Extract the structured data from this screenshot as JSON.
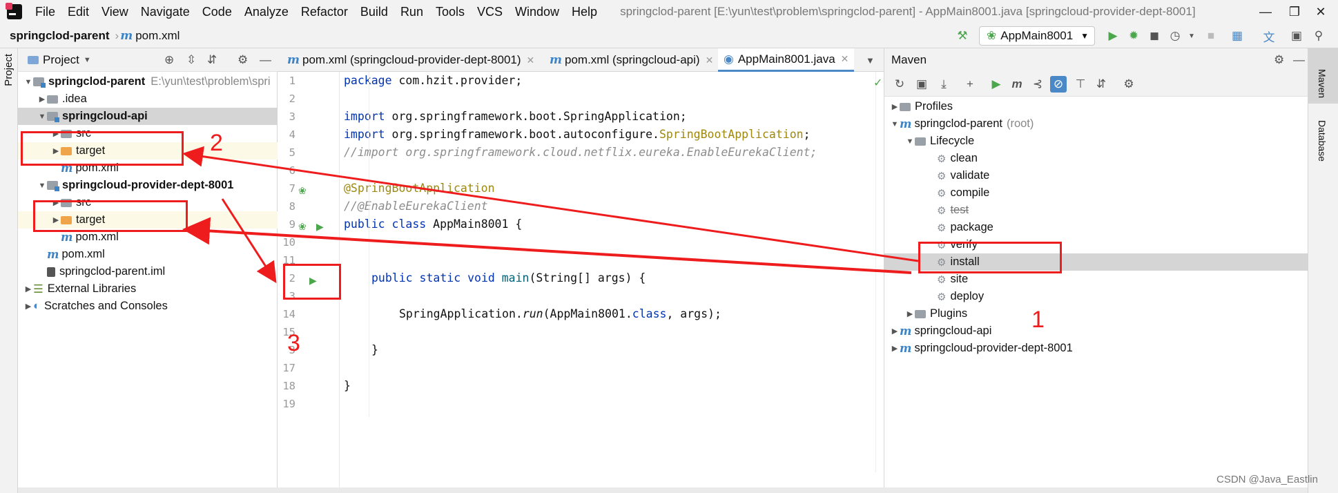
{
  "menubar": {
    "items": [
      "File",
      "Edit",
      "View",
      "Navigate",
      "Code",
      "Analyze",
      "Refactor",
      "Build",
      "Run",
      "Tools",
      "VCS",
      "Window",
      "Help"
    ],
    "window_title": "springclod-parent [E:\\yun\\test\\problem\\springclod-parent] - AppMain8001.java [springcloud-provider-dept-8001]"
  },
  "navbar": {
    "project": "springclod-parent",
    "file": "pom.xml",
    "run_config": "AppMain8001"
  },
  "left_strip": {
    "label": "Project"
  },
  "project_panel": {
    "title": "Project",
    "tree": [
      {
        "label": "springclod-parent",
        "path": "E:\\yun\\test\\problem\\spri"
      },
      {
        "label": ".idea"
      },
      {
        "label": "springcloud-api"
      },
      {
        "label": "src"
      },
      {
        "label": "target"
      },
      {
        "label": "pom.xml"
      },
      {
        "label": "springcloud-provider-dept-8001"
      },
      {
        "label": "src"
      },
      {
        "label": "target"
      },
      {
        "label": "pom.xml"
      },
      {
        "label": "pom.xml"
      },
      {
        "label": "springclod-parent.iml"
      },
      {
        "label": "External Libraries"
      },
      {
        "label": "Scratches and Consoles"
      }
    ]
  },
  "editor": {
    "tabs": [
      "pom.xml (springcloud-provider-dept-8001)",
      "pom.xml (springcloud-api)",
      "AppMain8001.java"
    ],
    "line_numbers": [
      "1",
      "2",
      "3",
      "4",
      "5",
      "6",
      "7",
      "8",
      "9",
      "10",
      "11",
      "2",
      "3",
      "14",
      "15",
      "3",
      "17",
      "18",
      "19"
    ],
    "code": {
      "l1_kw": "package",
      "l1_rest": " com.hzit.provider;",
      "l3_kw": "import",
      "l3_rest": " org.springframework.boot.SpringApplication;",
      "l4_kw": "import",
      "l4_rest": " org.springframework.boot.autoconfigure.",
      "l4_ann": "SpringBootApplication",
      "l4_end": ";",
      "l5": "//import org.springframework.cloud.netflix.eureka.EnableEurekaClient;",
      "l7": "@SpringBootApplication",
      "l8": "//@EnableEurekaClient",
      "l9_kw": "public class",
      "l9_rest": " AppMain8001 {",
      "l12_kw": "public static void",
      "l12_fn": " main",
      "l12_rest": "(String[] args) {",
      "l14_a": "SpringApplication.",
      "l14_fn": "run",
      "l14_b": "(AppMain8001.",
      "l14_kw": "class",
      "l14_c": ", args);",
      "l16": "}",
      "l18": "}"
    }
  },
  "maven": {
    "title": "Maven",
    "tree": {
      "profiles": "Profiles",
      "parent": "springclod-parent",
      "parent_suffix": "(root)",
      "lifecycle": "Lifecycle",
      "phases": [
        "clean",
        "validate",
        "compile",
        "test",
        "package",
        "verify",
        "install",
        "site",
        "deploy"
      ],
      "plugins": "Plugins",
      "modules": [
        "springcloud-api",
        "springcloud-provider-dept-8001"
      ]
    }
  },
  "right_strip": {
    "labels": [
      "Maven",
      "Database"
    ]
  },
  "annotations": {
    "labels": [
      "1",
      "2",
      "3"
    ],
    "color": "#ee1c1c"
  },
  "watermark": "CSDN @Java_Eastlin",
  "colors": {
    "accent": "#4a88c7",
    "run_green": "#4ca64c",
    "annotation_red": "#ee1c1c"
  }
}
